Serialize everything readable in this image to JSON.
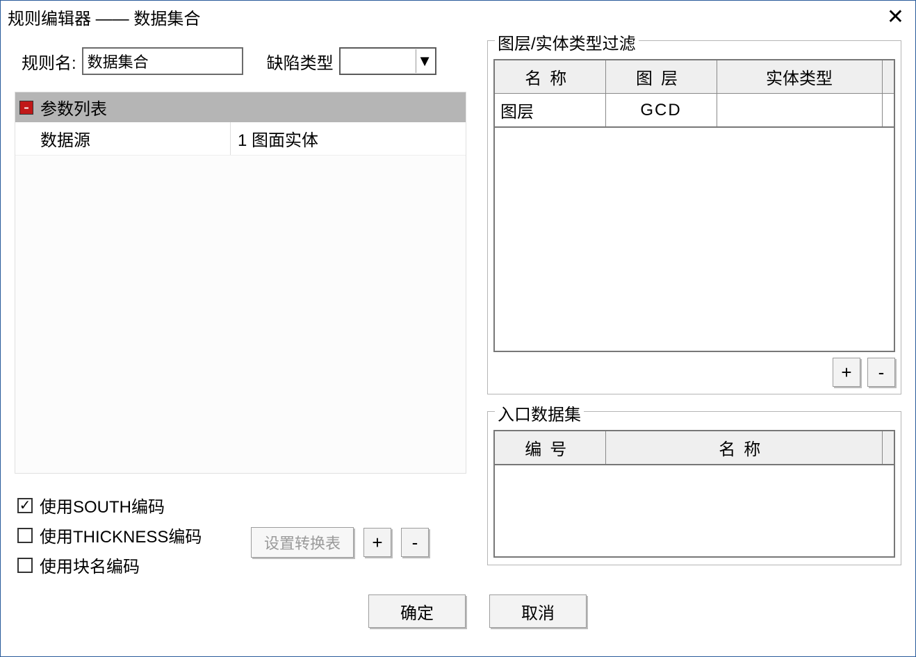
{
  "window": {
    "title": "规则编辑器 —— 数据集合"
  },
  "form": {
    "rule_name_label": "规则名:",
    "rule_name_value": "数据集合",
    "defect_type_label": "缺陷类型",
    "defect_type_value": ""
  },
  "param_list": {
    "header": "参数列表",
    "rows": [
      {
        "name": "数据源",
        "value": "1 图面实体"
      }
    ]
  },
  "checkboxes": {
    "south": {
      "label": "使用SOUTH编码",
      "checked": true
    },
    "thickness": {
      "label": "使用THICKNESS编码",
      "checked": false
    },
    "block": {
      "label": "使用块名编码",
      "checked": false
    }
  },
  "buttons": {
    "conv_table": "设置转换表",
    "plus": "+",
    "minus": "-",
    "ok": "确定",
    "cancel": "取消"
  },
  "filter_group": {
    "legend": "图层/实体类型过滤",
    "headers": {
      "name": "名称",
      "layer": "图层",
      "etype": "实体类型"
    },
    "rows": [
      {
        "name": "图层",
        "layer": "GCD",
        "etype": ""
      }
    ]
  },
  "entry_group": {
    "legend": "入口数据集",
    "headers": {
      "id": "编号",
      "name": "名称"
    },
    "rows": []
  }
}
